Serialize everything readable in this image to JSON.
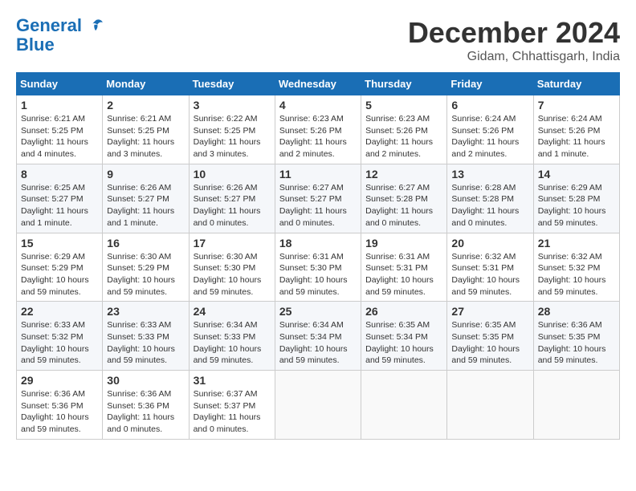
{
  "logo": {
    "line1": "General",
    "line2": "Blue"
  },
  "title": "December 2024",
  "location": "Gidam, Chhattisgarh, India",
  "days_of_week": [
    "Sunday",
    "Monday",
    "Tuesday",
    "Wednesday",
    "Thursday",
    "Friday",
    "Saturday"
  ],
  "weeks": [
    [
      {
        "day": "1",
        "sunrise": "6:21 AM",
        "sunset": "5:25 PM",
        "daylight": "11 hours and 4 minutes."
      },
      {
        "day": "2",
        "sunrise": "6:21 AM",
        "sunset": "5:25 PM",
        "daylight": "11 hours and 3 minutes."
      },
      {
        "day": "3",
        "sunrise": "6:22 AM",
        "sunset": "5:25 PM",
        "daylight": "11 hours and 3 minutes."
      },
      {
        "day": "4",
        "sunrise": "6:23 AM",
        "sunset": "5:26 PM",
        "daylight": "11 hours and 2 minutes."
      },
      {
        "day": "5",
        "sunrise": "6:23 AM",
        "sunset": "5:26 PM",
        "daylight": "11 hours and 2 minutes."
      },
      {
        "day": "6",
        "sunrise": "6:24 AM",
        "sunset": "5:26 PM",
        "daylight": "11 hours and 2 minutes."
      },
      {
        "day": "7",
        "sunrise": "6:24 AM",
        "sunset": "5:26 PM",
        "daylight": "11 hours and 1 minute."
      }
    ],
    [
      {
        "day": "8",
        "sunrise": "6:25 AM",
        "sunset": "5:27 PM",
        "daylight": "11 hours and 1 minute."
      },
      {
        "day": "9",
        "sunrise": "6:26 AM",
        "sunset": "5:27 PM",
        "daylight": "11 hours and 1 minute."
      },
      {
        "day": "10",
        "sunrise": "6:26 AM",
        "sunset": "5:27 PM",
        "daylight": "11 hours and 0 minutes."
      },
      {
        "day": "11",
        "sunrise": "6:27 AM",
        "sunset": "5:27 PM",
        "daylight": "11 hours and 0 minutes."
      },
      {
        "day": "12",
        "sunrise": "6:27 AM",
        "sunset": "5:28 PM",
        "daylight": "11 hours and 0 minutes."
      },
      {
        "day": "13",
        "sunrise": "6:28 AM",
        "sunset": "5:28 PM",
        "daylight": "11 hours and 0 minutes."
      },
      {
        "day": "14",
        "sunrise": "6:29 AM",
        "sunset": "5:28 PM",
        "daylight": "10 hours and 59 minutes."
      }
    ],
    [
      {
        "day": "15",
        "sunrise": "6:29 AM",
        "sunset": "5:29 PM",
        "daylight": "10 hours and 59 minutes."
      },
      {
        "day": "16",
        "sunrise": "6:30 AM",
        "sunset": "5:29 PM",
        "daylight": "10 hours and 59 minutes."
      },
      {
        "day": "17",
        "sunrise": "6:30 AM",
        "sunset": "5:30 PM",
        "daylight": "10 hours and 59 minutes."
      },
      {
        "day": "18",
        "sunrise": "6:31 AM",
        "sunset": "5:30 PM",
        "daylight": "10 hours and 59 minutes."
      },
      {
        "day": "19",
        "sunrise": "6:31 AM",
        "sunset": "5:31 PM",
        "daylight": "10 hours and 59 minutes."
      },
      {
        "day": "20",
        "sunrise": "6:32 AM",
        "sunset": "5:31 PM",
        "daylight": "10 hours and 59 minutes."
      },
      {
        "day": "21",
        "sunrise": "6:32 AM",
        "sunset": "5:32 PM",
        "daylight": "10 hours and 59 minutes."
      }
    ],
    [
      {
        "day": "22",
        "sunrise": "6:33 AM",
        "sunset": "5:32 PM",
        "daylight": "10 hours and 59 minutes."
      },
      {
        "day": "23",
        "sunrise": "6:33 AM",
        "sunset": "5:33 PM",
        "daylight": "10 hours and 59 minutes."
      },
      {
        "day": "24",
        "sunrise": "6:34 AM",
        "sunset": "5:33 PM",
        "daylight": "10 hours and 59 minutes."
      },
      {
        "day": "25",
        "sunrise": "6:34 AM",
        "sunset": "5:34 PM",
        "daylight": "10 hours and 59 minutes."
      },
      {
        "day": "26",
        "sunrise": "6:35 AM",
        "sunset": "5:34 PM",
        "daylight": "10 hours and 59 minutes."
      },
      {
        "day": "27",
        "sunrise": "6:35 AM",
        "sunset": "5:35 PM",
        "daylight": "10 hours and 59 minutes."
      },
      {
        "day": "28",
        "sunrise": "6:36 AM",
        "sunset": "5:35 PM",
        "daylight": "10 hours and 59 minutes."
      }
    ],
    [
      {
        "day": "29",
        "sunrise": "6:36 AM",
        "sunset": "5:36 PM",
        "daylight": "10 hours and 59 minutes."
      },
      {
        "day": "30",
        "sunrise": "6:36 AM",
        "sunset": "5:36 PM",
        "daylight": "11 hours and 0 minutes."
      },
      {
        "day": "31",
        "sunrise": "6:37 AM",
        "sunset": "5:37 PM",
        "daylight": "11 hours and 0 minutes."
      },
      null,
      null,
      null,
      null
    ]
  ]
}
